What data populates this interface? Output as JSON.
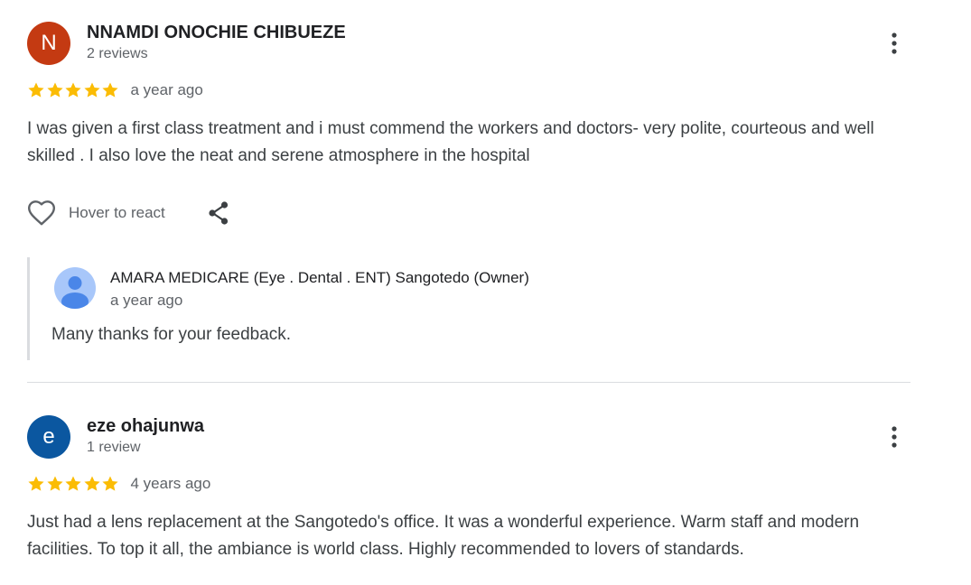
{
  "colors": {
    "star": "#fbbc04",
    "avatar_n": "#c43a12",
    "avatar_e": "#0b57a0",
    "owner_avatar_bg": "#a8c7fa",
    "owner_avatar_fg": "#4a86e8",
    "icon": "#5f6368",
    "divider": "#dadce0"
  },
  "reviews": [
    {
      "avatar_letter": "N",
      "author": "NNAMDI ONOCHIE CHIBUEZE",
      "review_count": "2 reviews",
      "rating": 5,
      "time": "a year ago",
      "text": "I was given a first class treatment and i must commend the workers and doctors- very polite, courteous and well skilled . I also love the neat and serene atmosphere in the hospital",
      "react_label": "Hover to react",
      "icons": [
        "more-vert-icon",
        "heart-icon",
        "share-icon"
      ],
      "owner_response": {
        "name": "AMARA MEDICARE (Eye . Dental . ENT) Sangotedo (Owner)",
        "time": "a year ago",
        "text": "Many thanks for your feedback.",
        "icon": "default-profile-icon"
      }
    },
    {
      "avatar_letter": "e",
      "author": "eze ohajunwa",
      "review_count": "1 review",
      "rating": 5,
      "time": "4 years ago",
      "text": "Just had a lens replacement at the Sangotedo's office. It was a wonderful experience. Warm staff and modern facilities. To top it all, the ambiance is world class. Highly recommended to lovers of standards.",
      "icons": [
        "more-vert-icon"
      ]
    }
  ]
}
